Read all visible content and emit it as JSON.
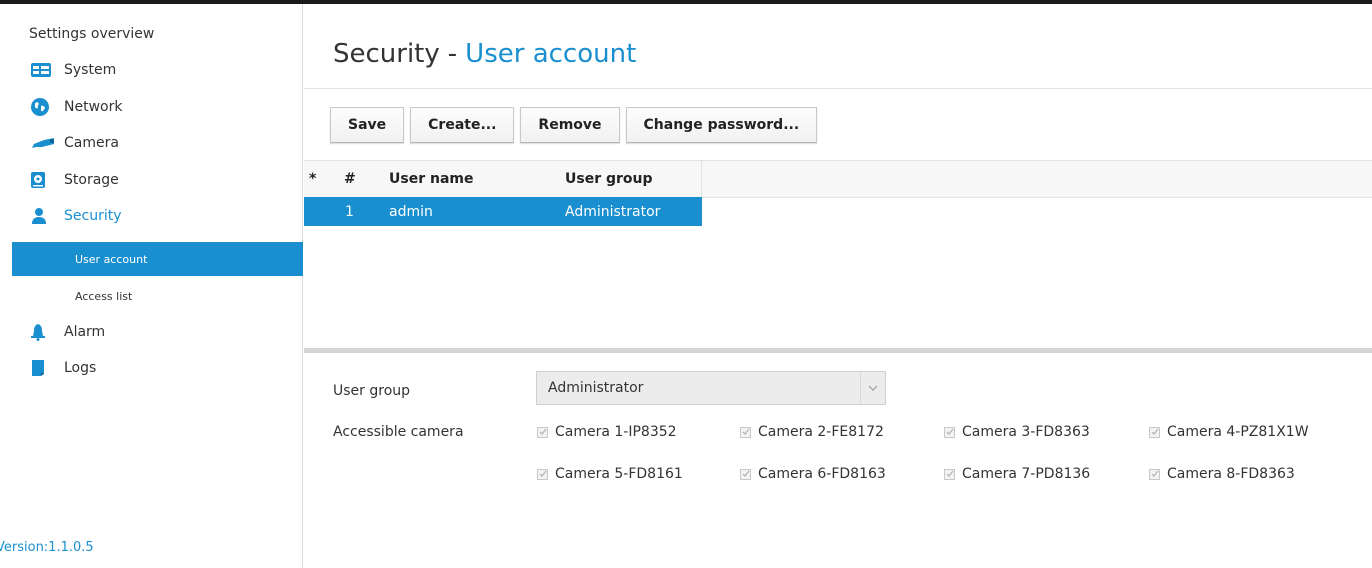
{
  "sidebar": {
    "title": "Settings overview",
    "items": [
      {
        "label": "System",
        "icon": "system-icon"
      },
      {
        "label": "Network",
        "icon": "globe-icon"
      },
      {
        "label": "Camera",
        "icon": "camera-icon"
      },
      {
        "label": "Storage",
        "icon": "storage-icon"
      },
      {
        "label": "Security",
        "icon": "user-icon"
      },
      {
        "label": "Alarm",
        "icon": "bell-icon"
      },
      {
        "label": "Logs",
        "icon": "logs-icon"
      }
    ],
    "security_subitems": [
      "User account",
      "Access list"
    ],
    "version": "Version:1.1.0.5"
  },
  "header": {
    "title": "Security",
    "separator": "-",
    "subtitle": "User account"
  },
  "toolbar": {
    "save_label": "Save",
    "create_label": "Create...",
    "remove_label": "Remove",
    "change_password_label": "Change password..."
  },
  "table": {
    "columns": [
      "*",
      "#",
      "User name",
      "User group"
    ],
    "rows": [
      {
        "index": "1",
        "user_name": "admin",
        "user_group": "Administrator"
      }
    ]
  },
  "form": {
    "user_group_label": "User group",
    "user_group_value": "Administrator",
    "accessible_camera_label": "Accessible camera",
    "cameras": [
      "Camera 1-IP8352",
      "Camera 2-FE8172",
      "Camera 3-FD8363",
      "Camera 4-PZ81X1W",
      "Camera 5-FD8161",
      "Camera 6-FD8163",
      "Camera 7-PD8136",
      "Camera 8-FD8363"
    ]
  },
  "colors": {
    "accent": "#1a8fd0",
    "text": "#333333",
    "toolbar_border": "#c9c9c9"
  }
}
